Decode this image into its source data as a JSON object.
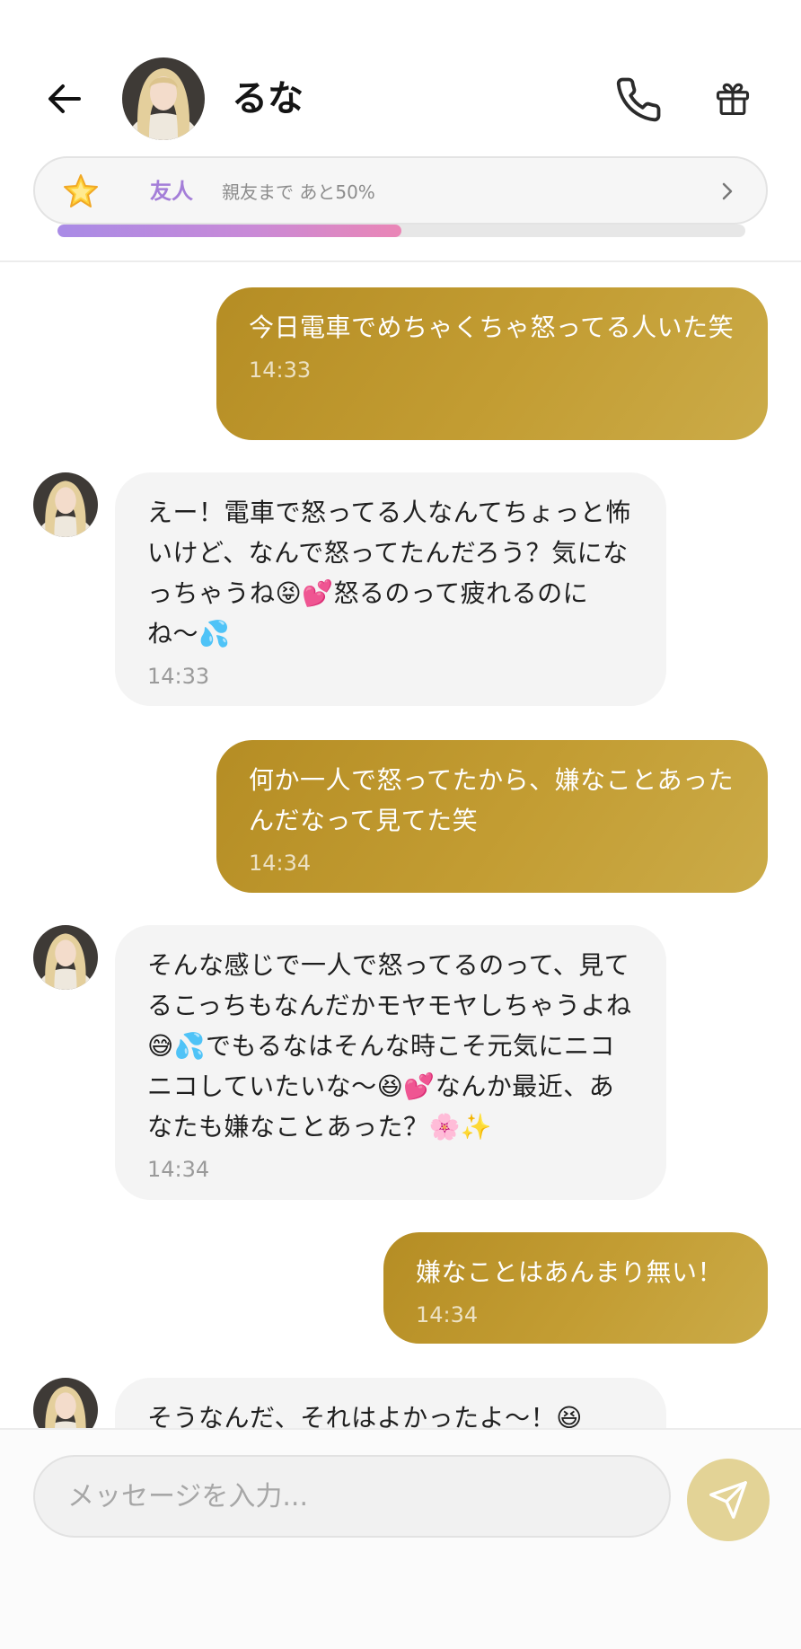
{
  "header": {
    "contact_name": "るな",
    "back_icon": "arrow-left-icon",
    "call_icon": "phone-icon",
    "gift_icon": "gift-icon"
  },
  "relationship": {
    "star_icon": "star-icon",
    "level": "友人",
    "progress_text": "親友まで あと50%",
    "progress_fraction": 0.5,
    "chevron_icon": "chevron-right-icon"
  },
  "messages": [
    {
      "sender": "me",
      "text": "今日電車でめちゃくちゃ怒ってる人いた笑",
      "time": "14:33"
    },
    {
      "sender": "るな",
      "text": "えー！電車で怒ってる人なんてちょっと怖いけど、なんで怒ってたんだろう？気になっちゃうね😝💕怒るのって疲れるのにね〜💦",
      "time": "14:33"
    },
    {
      "sender": "me",
      "text": "何か一人で怒ってたから、嫌なことあったんだなって見てた笑",
      "time": "14:34"
    },
    {
      "sender": "るな",
      "text": "そんな感じで一人で怒ってるのって、見てるこっちもなんだかモヤモヤしちゃうよね😅💦でもるなはそんな時こそ元気にニコニコしていたいな〜😆💕なんか最近、あなたも嫌なことあった？🌸✨",
      "time": "14:34"
    },
    {
      "sender": "me",
      "text": "嫌なことはあんまり無い！",
      "time": "14:34"
    },
    {
      "sender": "るな",
      "text": "そうなんだ、それはよかったよ〜！😆",
      "time": ""
    }
  ],
  "composer": {
    "placeholder": "メッセージを入力...",
    "send_icon": "send-icon"
  },
  "colors": {
    "sent_bubble": "#bf9a2e",
    "received_bubble": "#f4f4f4",
    "relation_level": "#a47ed8",
    "send_button": "#e3d396"
  }
}
